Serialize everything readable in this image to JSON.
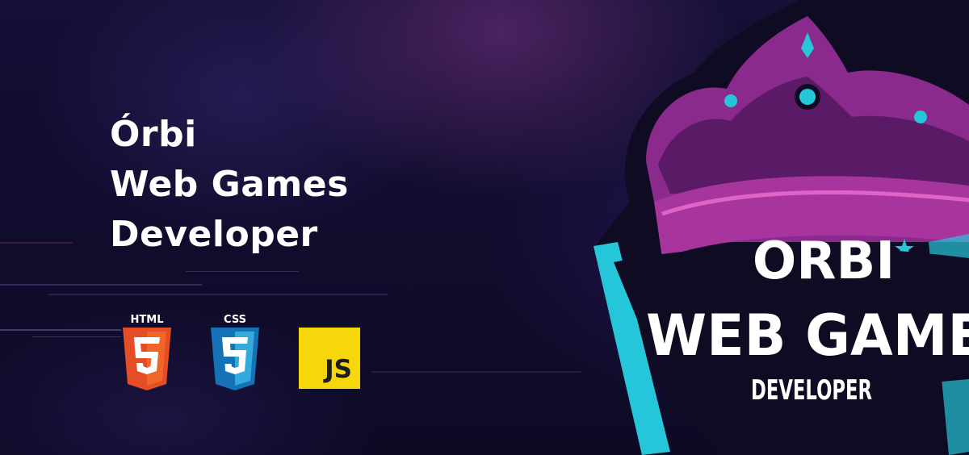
{
  "headline": {
    "line1": "Órbi",
    "line2": "Web Games",
    "line3": "Developer"
  },
  "tech_icons": {
    "html": {
      "caption": "HTML",
      "number": "5",
      "color": "#e44d26"
    },
    "css": {
      "caption": "CSS",
      "number": "3",
      "color": "#1572b6"
    },
    "js": {
      "caption": "JS",
      "color": "#f7df1e"
    }
  },
  "logo": {
    "line1": "ORBI",
    "line2": "WEB GAME",
    "line3": "DEVELOPER",
    "colors": {
      "crown": "#8a2a8c",
      "accent": "#26c6da",
      "outline": "#0f0b22"
    }
  }
}
